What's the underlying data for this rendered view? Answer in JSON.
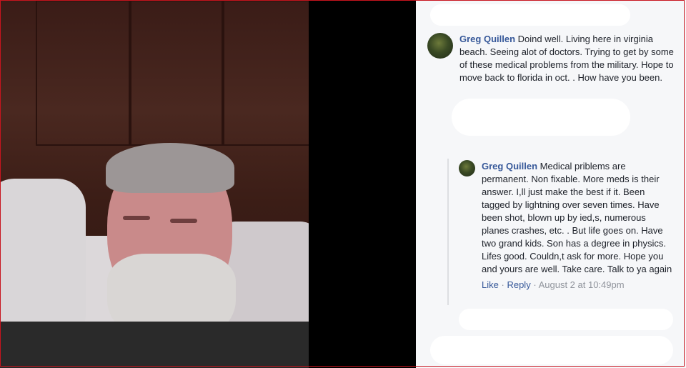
{
  "comments": [
    {
      "author": "Greg Quillen",
      "text": "Doind well. Living here in virginia beach. Seeing alot of doctors. Trying to get by some of these medical problems from the military. Hope to move back to florida in oct. . How have you been."
    },
    {
      "author": "Greg Quillen",
      "text": "Medical priblems are permanent. Non fixable. More meds is their answer. I,ll just make the best if it. Been tagged by lightning over seven times. Have been shot, blown up by ied,s, numerous planes crashes, etc. . But life goes on. Have two grand kids. Son has a degree in physics. Lifes good. Couldn,t ask for more. Hope you and yours are well. Take care. Talk to ya again",
      "actions": {
        "like": "Like",
        "separator": "·",
        "reply": "Reply",
        "timestamp": "August 2 at 10:49pm"
      }
    }
  ]
}
